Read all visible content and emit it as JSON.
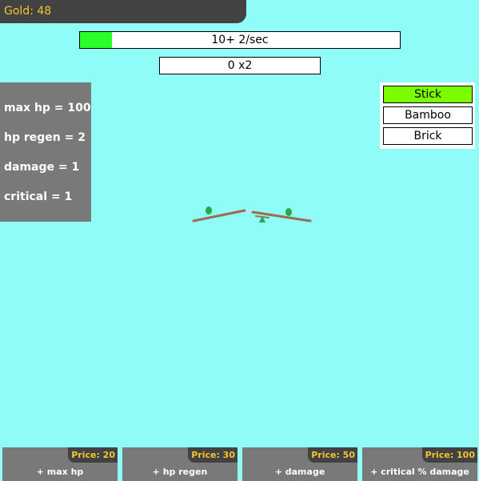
{
  "gold": {
    "label": "Gold: 48"
  },
  "enemy": {
    "hp_text": "10+ 2/sec",
    "hp_fraction": 0.1,
    "hp_fill_color": "#2bff2b",
    "combo_text": "0 x2"
  },
  "stats": [
    {
      "text": "max hp = 100"
    },
    {
      "text": "hp regen = 2"
    },
    {
      "text": "damage = 1"
    },
    {
      "text": "critical = 1"
    }
  ],
  "weapons": [
    {
      "label": "Stick",
      "selected": true
    },
    {
      "label": "Bamboo",
      "selected": false
    },
    {
      "label": "Brick",
      "selected": false
    }
  ],
  "shop": [
    {
      "price": "Price: 20",
      "label": "+ max hp"
    },
    {
      "price": "Price: 30",
      "label": "+ hp regen"
    },
    {
      "price": "Price: 50",
      "label": "+ damage"
    },
    {
      "price": "Price: 100",
      "label": "+ critical % damage"
    }
  ],
  "colors": {
    "background": "#8ffcf8",
    "panel": "#797979",
    "dark": "#424242",
    "gold_text": "#f4c430",
    "selected_weapon": "#7cfc00"
  },
  "target_sprite": {
    "icon": "stick-icon"
  }
}
